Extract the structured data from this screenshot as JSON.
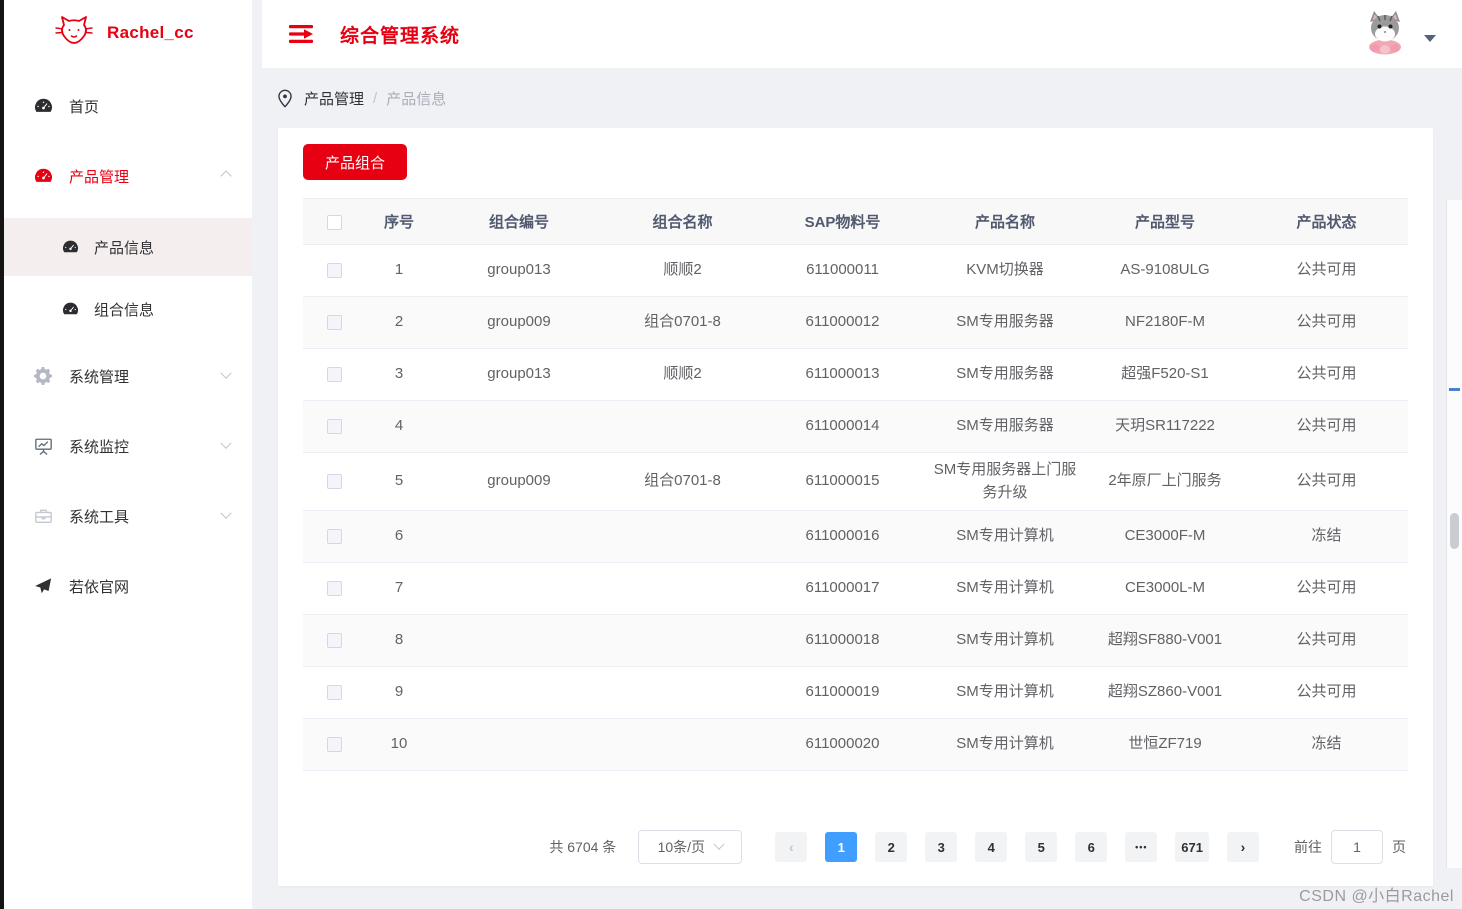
{
  "colors": {
    "brand_red": "#e60012",
    "active_page_blue": "#409eff",
    "selected_menu_bg": "#f5eeee"
  },
  "sidebar": {
    "logo_text": "Rachel_cc",
    "menu": [
      {
        "label": "首页"
      },
      {
        "label": "产品管理",
        "expanded": true,
        "children": [
          {
            "label": "产品信息",
            "selected": true
          },
          {
            "label": "组合信息"
          }
        ]
      },
      {
        "label": "系统管理"
      },
      {
        "label": "系统监控"
      },
      {
        "label": "系统工具"
      },
      {
        "label": "若依官网"
      }
    ]
  },
  "header": {
    "title": "综合管理系统"
  },
  "breadcrumb": {
    "items": [
      "产品管理",
      "产品信息"
    ],
    "separator": "/"
  },
  "toolbar": {
    "combo_button_label": "产品组合"
  },
  "table": {
    "columns": [
      "序号",
      "组合编号",
      "组合名称",
      "SAP物料号",
      "产品名称",
      "产品型号",
      "产品状态"
    ],
    "rows": [
      {
        "no": "1",
        "combo_code": "group013",
        "combo_name": "顺顺2",
        "sap_no": "611000011",
        "product_name": "KVM切换器",
        "product_model": "AS-9108ULG",
        "status": "公共可用"
      },
      {
        "no": "2",
        "combo_code": "group009",
        "combo_name": "组合0701-8",
        "sap_no": "611000012",
        "product_name": "SM专用服务器",
        "product_model": "NF2180F-M",
        "status": "公共可用"
      },
      {
        "no": "3",
        "combo_code": "group013",
        "combo_name": "顺顺2",
        "sap_no": "611000013",
        "product_name": "SM专用服务器",
        "product_model": "超强F520-S1",
        "status": "公共可用"
      },
      {
        "no": "4",
        "combo_code": "",
        "combo_name": "",
        "sap_no": "611000014",
        "product_name": "SM专用服务器",
        "product_model": "天玥SR117222",
        "status": "公共可用"
      },
      {
        "no": "5",
        "combo_code": "group009",
        "combo_name": "组合0701-8",
        "sap_no": "611000015",
        "product_name": "SM专用服务器上门服务升级",
        "product_model": "2年原厂上门服务",
        "status": "公共可用"
      },
      {
        "no": "6",
        "combo_code": "",
        "combo_name": "",
        "sap_no": "611000016",
        "product_name": "SM专用计算机",
        "product_model": "CE3000F-M",
        "status": "冻结"
      },
      {
        "no": "7",
        "combo_code": "",
        "combo_name": "",
        "sap_no": "611000017",
        "product_name": "SM专用计算机",
        "product_model": "CE3000L-M",
        "status": "公共可用"
      },
      {
        "no": "8",
        "combo_code": "",
        "combo_name": "",
        "sap_no": "611000018",
        "product_name": "SM专用计算机",
        "product_model": "超翔SF880-V001",
        "status": "公共可用"
      },
      {
        "no": "9",
        "combo_code": "",
        "combo_name": "",
        "sap_no": "611000019",
        "product_name": "SM专用计算机",
        "product_model": "超翔SZ860-V001",
        "status": "公共可用"
      },
      {
        "no": "10",
        "combo_code": "",
        "combo_name": "",
        "sap_no": "611000020",
        "product_name": "SM专用计算机",
        "product_model": "世恒ZF719",
        "status": "冻结"
      }
    ]
  },
  "pagination": {
    "total_label": "共 6704 条",
    "page_size_label": "10条/页",
    "pages": [
      "1",
      "2",
      "3",
      "4",
      "5",
      "6"
    ],
    "active_page": "1",
    "ellipsis": "•••",
    "last_page": "671",
    "goto_label": "前往",
    "goto_value": "1",
    "goto_unit": "页"
  },
  "watermark": {
    "text": "CSDN @小白Rachel"
  }
}
